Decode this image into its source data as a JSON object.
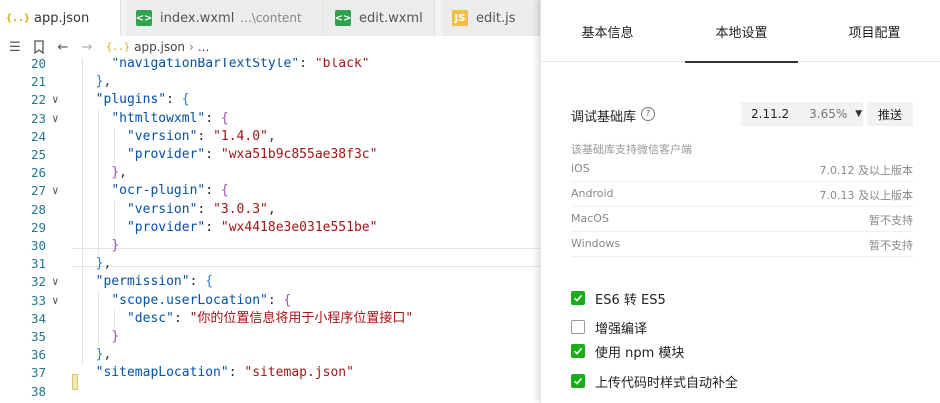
{
  "tabs": [
    {
      "label": "app.json",
      "icon": "json-file-icon",
      "active": true
    },
    {
      "label": "index.wxml",
      "hint": "...\\content",
      "icon": "wxml-file-icon"
    },
    {
      "label": "edit.wxml",
      "icon": "wxml-file-icon"
    },
    {
      "label": "edit.js",
      "icon": "js-file-icon"
    }
  ],
  "breadcrumb": {
    "file": "app.json",
    "rest": "..."
  },
  "editor": {
    "lines": [
      {
        "n": "20",
        "text": "    \"navigationBarTextStyle\": \"black\""
      },
      {
        "n": "21",
        "text": "  },"
      },
      {
        "n": "22",
        "text": "  \"plugins\": {"
      },
      {
        "n": "23",
        "text": "    \"htmltowxml\": {"
      },
      {
        "n": "24",
        "text": "      \"version\": \"1.4.0\","
      },
      {
        "n": "25",
        "text": "      \"provider\": \"wxa51b9c855ae38f3c\""
      },
      {
        "n": "26",
        "text": "    },"
      },
      {
        "n": "27",
        "text": "    \"ocr-plugin\": {"
      },
      {
        "n": "28",
        "text": "      \"version\": \"3.0.3\","
      },
      {
        "n": "29",
        "text": "      \"provider\": \"wx4418e3e031e551be\""
      },
      {
        "n": "30",
        "text": "    }"
      },
      {
        "n": "31",
        "text": "  },"
      },
      {
        "n": "32",
        "text": "  \"permission\": {"
      },
      {
        "n": "33",
        "text": "    \"scope.userLocation\": {"
      },
      {
        "n": "34",
        "text": "      \"desc\": \"你的位置信息将用于小程序位置接口\""
      },
      {
        "n": "35",
        "text": "    }"
      },
      {
        "n": "36",
        "text": "  },"
      },
      {
        "n": "37",
        "text": "  \"sitemapLocation\": \"sitemap.json\""
      },
      {
        "n": "38",
        "text": ""
      }
    ]
  },
  "panel": {
    "tabs": [
      "基本信息",
      "本地设置",
      "项目配置"
    ],
    "active_tab": "本地设置",
    "lib_label": "调试基础库",
    "lib_version": "2.11.2",
    "lib_percent": "3.65%",
    "push_label": "推送",
    "support_note": "该基础库支持微信客户端",
    "platforms": [
      {
        "name": "iOS",
        "value": "7.0.12 及以上版本"
      },
      {
        "name": "Android",
        "value": "7.0.13 及以上版本"
      },
      {
        "name": "MacOS",
        "value": "暂不支持"
      },
      {
        "name": "Windows",
        "value": "暂不支持"
      }
    ],
    "checkboxes": [
      {
        "label": "ES6 转 ES5",
        "checked": true
      },
      {
        "label": "增强编译",
        "checked": false
      },
      {
        "label": "使用 npm 模块",
        "checked": true
      },
      {
        "label": "上传代码时样式自动补全",
        "checked": true
      }
    ]
  },
  "colors": {
    "check_green": "#1aad19",
    "line_number": "#237893",
    "json_key": "#0451a5",
    "json_string": "#a31515"
  }
}
